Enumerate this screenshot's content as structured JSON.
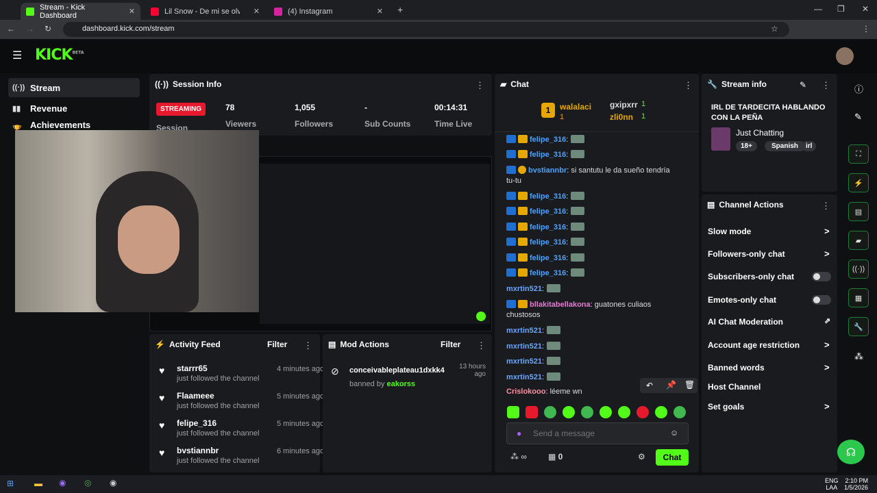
{
  "browser": {
    "tabs": [
      {
        "title": "Stream - Kick Dashboard",
        "color": "#53fc18"
      },
      {
        "title": "Lil Snow - De mi se olvidó",
        "color": "#ff0033"
      },
      {
        "title": "(4) Instagram",
        "color": "#d6249f"
      }
    ],
    "url": "dashboard.kick.com/stream"
  },
  "header": {
    "logo": "KICK",
    "beta": "BETA"
  },
  "sidebar": {
    "items": [
      {
        "label": "Stream",
        "icon": "broadcast-icon"
      },
      {
        "label": "Revenue",
        "icon": "chart-icon"
      },
      {
        "label": "Achievements",
        "icon": "trophy-icon"
      }
    ]
  },
  "session": {
    "title": "Session Info",
    "status": "STREAMING",
    "status_label": "Session",
    "stats": [
      {
        "value": "78",
        "label": "Viewers"
      },
      {
        "value": "1,055",
        "label": "Followers"
      },
      {
        "value": "-",
        "label": "Sub Counts"
      },
      {
        "value": "00:14:31",
        "label": "Time Live"
      }
    ]
  },
  "chat": {
    "title": "Chat",
    "top": [
      {
        "rank": "1",
        "name": "walalaci",
        "count": "1"
      },
      {
        "name": "gxipxrr",
        "count": "1"
      },
      {
        "name": "zli0nn",
        "count": "1"
      }
    ],
    "messages": [
      {
        "user": "felipe_316",
        "text": ":",
        "color": "#4aa3ff"
      },
      {
        "user": "felipe_316",
        "text": ":",
        "color": "#4aa3ff"
      },
      {
        "user": "bvstiannbr",
        "text": ": si santutu le da sueño tendría",
        "color": "#4aa3ff"
      },
      {
        "user": "",
        "text": "tu-tu",
        "color": "#ddd"
      },
      {
        "user": "felipe_316",
        "text": ":",
        "color": "#4aa3ff"
      },
      {
        "user": "felipe_316",
        "text": ":",
        "color": "#4aa3ff"
      },
      {
        "user": "felipe_316",
        "text": ":",
        "color": "#4aa3ff"
      },
      {
        "user": "felipe_316",
        "text": ":",
        "color": "#4aa3ff"
      },
      {
        "user": "felipe_316",
        "text": ":",
        "color": "#4aa3ff"
      },
      {
        "user": "felipe_316",
        "text": ":",
        "color": "#4aa3ff"
      },
      {
        "user": "mxrtin521",
        "text": ":",
        "color": "#6aa6ff"
      },
      {
        "user": "bllakitabellakona",
        "text": ": guatones culiaos",
        "color": "#e77bd3"
      },
      {
        "user": "",
        "text": "chustosos",
        "color": "#ddd"
      },
      {
        "user": "mxrtin521",
        "text": ":",
        "color": "#6aa6ff"
      },
      {
        "user": "mxrtin521",
        "text": ":",
        "color": "#6aa6ff"
      },
      {
        "user": "mxrtin521",
        "text": ":",
        "color": "#6aa6ff"
      },
      {
        "user": "mxrtin521",
        "text": ":",
        "color": "#6aa6ff"
      },
      {
        "user": "Crislokooo",
        "text": ": léeme wn",
        "color": "#ff8fa3"
      }
    ],
    "placeholder": "Send a message",
    "viewer_count": "0",
    "send_label": "Chat"
  },
  "stream_info": {
    "title": "Stream info",
    "stream_title": "IRL DE TARDECITA HABLANDO CON LA PEÑA",
    "category": "Just Chatting",
    "tags": [
      "18+",
      "Spanish",
      "irl"
    ]
  },
  "channel_actions": {
    "title": "Channel Actions",
    "items": [
      {
        "label": "Slow mode",
        "control": "chevron"
      },
      {
        "label": "Followers-only chat",
        "control": "chevron"
      },
      {
        "label": "Subscribers-only chat",
        "control": "toggle"
      },
      {
        "label": "Emotes-only chat",
        "control": "toggle"
      },
      {
        "label": "AI Chat Moderation",
        "control": "external"
      },
      {
        "label": "Account age restriction",
        "control": "chevron"
      },
      {
        "label": "Banned words",
        "control": "chevron"
      },
      {
        "label": "Host Channel",
        "control": "none"
      },
      {
        "label": "Set goals",
        "control": "chevron"
      }
    ]
  },
  "activity": {
    "title": "Activity Feed",
    "filter": "Filter",
    "items": [
      {
        "name": "starrr65",
        "desc": "just followed the channel",
        "time": "4 minutes ago"
      },
      {
        "name": "Flaameee",
        "desc": "just followed the channel",
        "time": "5 minutes ago"
      },
      {
        "name": "felipe_316",
        "desc": "just followed the channel",
        "time": "5 minutes ago"
      },
      {
        "name": "bvstiannbr",
        "desc": "just followed the channel",
        "time": "6 minutes ago"
      }
    ]
  },
  "mod_actions": {
    "title": "Mod Actions",
    "filter": "Filter",
    "item": {
      "user": "conceivableplateau1dxkk4",
      "time": "13 hours ago",
      "by_prefix": "banned by",
      "by": "eakorss"
    }
  },
  "taskbar": {
    "lang": "ENG",
    "region": "LAA",
    "time": "2:10 PM",
    "date": "1/5/2026"
  },
  "colors": {
    "accent": "#53fc18",
    "streaming": "#e8192c",
    "panel": "#1a1b1e"
  }
}
